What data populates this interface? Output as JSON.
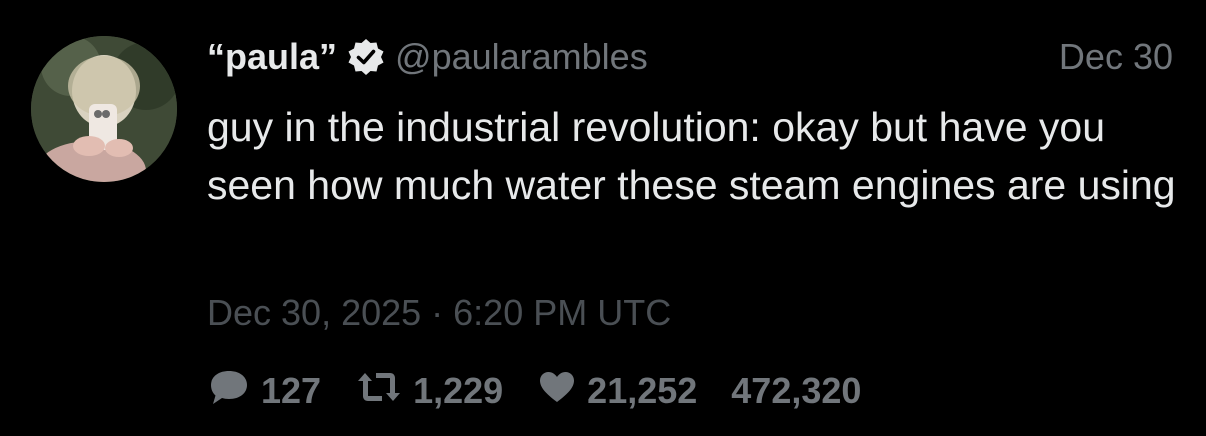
{
  "tweet": {
    "display_name": "“paula”",
    "handle": "@paularambles",
    "date_short": "Dec 30",
    "text": "guy in the industrial revolution: okay but have you seen how much water these steam engines are using",
    "timestamp": "Dec 30, 2025 · 6:20 PM UTC",
    "stats": {
      "replies": "127",
      "retweets": "1,229",
      "likes": "21,252",
      "views": "472,320"
    }
  },
  "icons": {
    "verified": "verified-badge-icon",
    "reply": "speech-bubble-icon",
    "retweet": "retweet-icon",
    "like": "heart-icon"
  },
  "colors": {
    "background": "#000000",
    "primary_text": "#e7e9ea",
    "secondary_text": "#71767b",
    "muted_text": "#4a4f54"
  }
}
